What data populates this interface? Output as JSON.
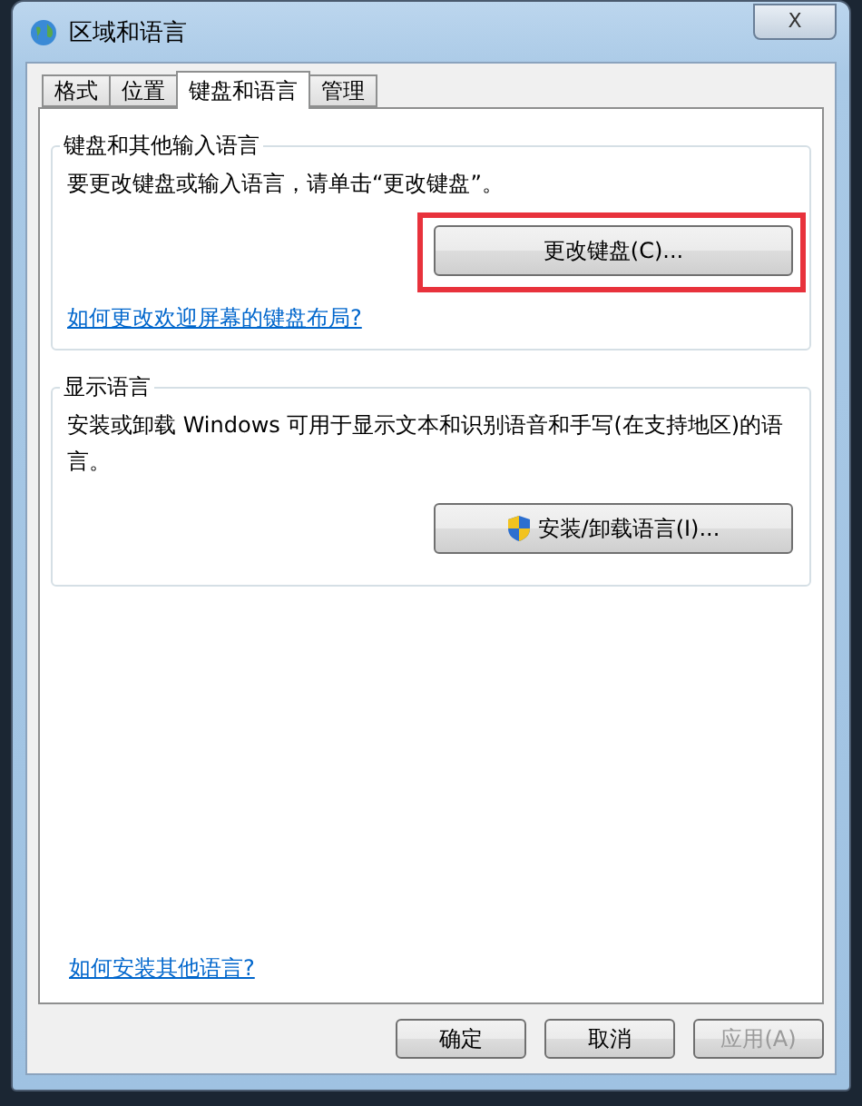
{
  "window": {
    "title": "区域和语言",
    "close_label": "X"
  },
  "tabs": [
    {
      "label": "格式",
      "selected": false
    },
    {
      "label": "位置",
      "selected": false
    },
    {
      "label": "键盘和语言",
      "selected": true
    },
    {
      "label": "管理",
      "selected": false
    }
  ],
  "groups": [
    {
      "title": "键盘和其他输入语言",
      "text": "要更改键盘或输入语言，请单击“更改键盘”。",
      "button": {
        "label": "更改键盘(C)...",
        "shield": false,
        "highlighted": true
      },
      "link": "如何更改欢迎屏幕的键盘布局?"
    },
    {
      "title": "显示语言",
      "text": "安装或卸载 Windows 可用于显示文本和识别语音和手写(在支持地区)的语言。",
      "button": {
        "label": "安装/卸载语言(I)...",
        "shield": true,
        "highlighted": false
      }
    }
  ],
  "bottom_link": "如何安装其他语言?",
  "buttons": [
    {
      "label": "确定",
      "disabled": false
    },
    {
      "label": "取消",
      "disabled": false
    },
    {
      "label": "应用(A)",
      "disabled": true
    }
  ]
}
